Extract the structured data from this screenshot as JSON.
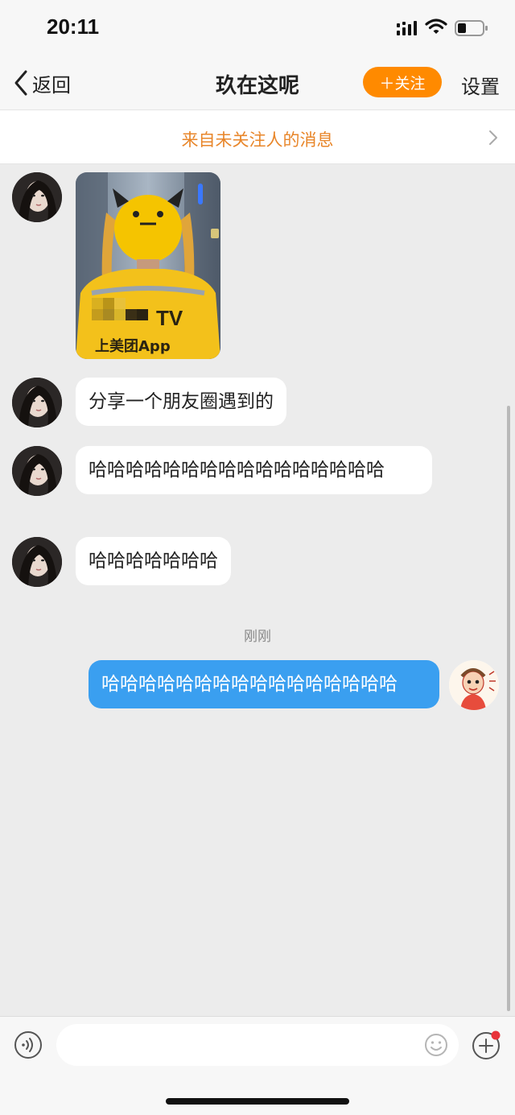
{
  "status_bar": {
    "time": "20:11"
  },
  "nav": {
    "back_label": "返回",
    "title": "玖在这呢",
    "follow_label": "＋关注",
    "settings_label": "设置"
  },
  "banner": {
    "text": "来自未关注人的消息"
  },
  "messages": [
    {
      "type": "image",
      "direction": "in",
      "image_text": [
        "上美团App"
      ]
    },
    {
      "type": "text",
      "direction": "in",
      "text": "分享一个朋友圈遇到的"
    },
    {
      "type": "text",
      "direction": "in",
      "text": "哈哈哈哈哈哈哈哈哈哈哈哈哈哈哈哈"
    },
    {
      "type": "text",
      "direction": "in",
      "text": "哈哈哈哈哈哈哈"
    },
    {
      "type": "text",
      "direction": "out",
      "text": "哈哈哈哈哈哈哈哈哈哈哈哈哈哈哈哈"
    }
  ],
  "timestamp": "刚刚",
  "input": {
    "placeholder": ""
  },
  "colors": {
    "accent_orange": "#ff8a00",
    "banner_text": "#e8862a",
    "outgoing_bubble": "#3a9ff0",
    "notification_dot": "#e8333a"
  },
  "icons": [
    "back-chevron-icon",
    "signal-icon",
    "wifi-icon",
    "battery-icon",
    "chevron-right-icon",
    "voice-icon",
    "emoji-icon",
    "plus-icon"
  ]
}
